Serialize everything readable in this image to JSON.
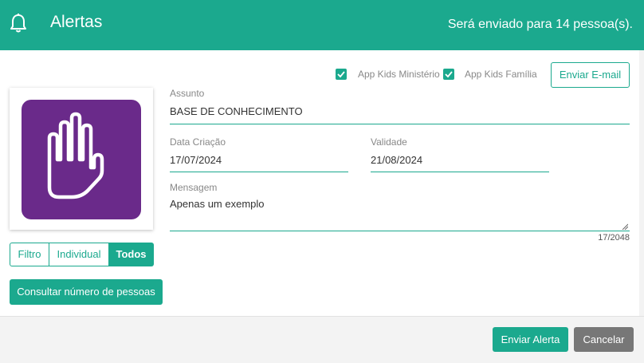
{
  "header": {
    "title": "Alertas",
    "recipients_text": "Será enviado para 14 pessoa(s).",
    "icon": "bell-icon"
  },
  "colors": {
    "accent": "#1ba98e",
    "logo_bg": "#6a2a8a",
    "cancel": "#777777"
  },
  "options": {
    "app_kids_ministerio": {
      "label": "App Kids Ministério",
      "checked": true
    },
    "app_kids_familia": {
      "label": "App Kids Família",
      "checked": true
    }
  },
  "buttons": {
    "send_email": "Enviar E-mail",
    "consult": "Consultar número de pessoas",
    "send_alert": "Enviar Alerta",
    "cancel": "Cancelar"
  },
  "filter_tabs": [
    {
      "label": "Filtro",
      "active": false
    },
    {
      "label": "Individual",
      "active": false
    },
    {
      "label": "Todos",
      "active": true
    }
  ],
  "form": {
    "subject_label": "Assunto",
    "subject_value": "BASE DE CONHECIMENTO",
    "created_label": "Data Criação",
    "created_value": "17/07/2024",
    "validity_label": "Validade",
    "validity_value": "21/08/2024",
    "message_label": "Mensagem",
    "message_value": "Apenas um exemplo",
    "char_counter": "17/2048"
  },
  "logo": {
    "icon": "hand-icon"
  }
}
